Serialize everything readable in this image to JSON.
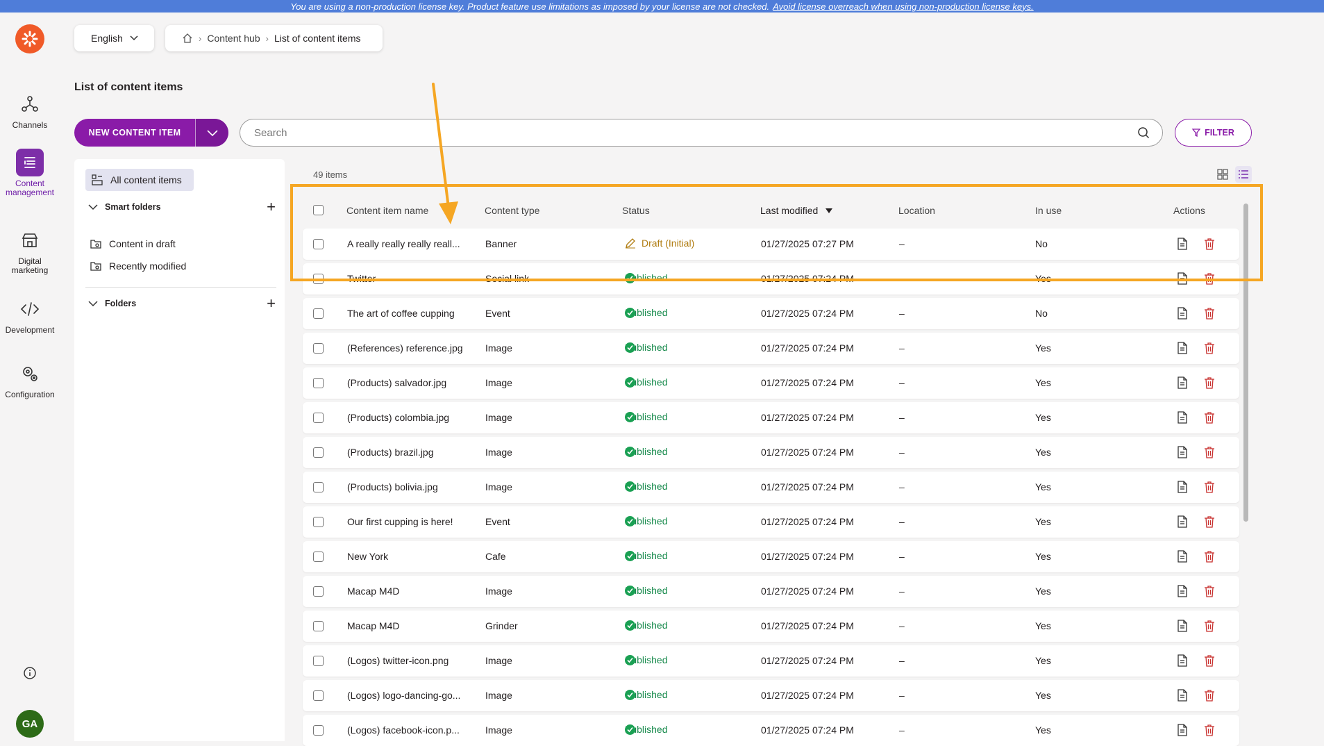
{
  "banner": {
    "text": "You are using a non-production license key. Product feature use limitations as imposed by your license are not checked.",
    "link": "Avoid license overreach when using non-production license keys."
  },
  "rail": {
    "items": [
      {
        "label": "Channels",
        "icon": "channels-icon"
      },
      {
        "label": "Content management",
        "icon": "content-management-icon",
        "active": true
      },
      {
        "label": "Digital marketing",
        "icon": "digital-marketing-icon"
      },
      {
        "label": "Development",
        "icon": "code-icon"
      },
      {
        "label": "Configuration",
        "icon": "gears-icon"
      }
    ],
    "avatar": "GA"
  },
  "header": {
    "language": "English",
    "breadcrumb": [
      "Content hub",
      "List of content items"
    ],
    "title": "List of content items"
  },
  "toolbar": {
    "new_label": "NEW CONTENT ITEM",
    "search_placeholder": "Search",
    "filter_label": "FILTER"
  },
  "folders": {
    "all_items": "All content items",
    "smart_folders_label": "Smart folders",
    "smart_folders": [
      "Content in draft",
      "Recently modified"
    ],
    "folders_label": "Folders"
  },
  "list": {
    "count": "49 items",
    "columns": {
      "name": "Content item name",
      "type": "Content type",
      "status": "Status",
      "modified": "Last modified",
      "location": "Location",
      "in_use": "In use",
      "actions": "Actions"
    },
    "sort_column": "Last modified",
    "sort_direction": "descending",
    "rows": [
      {
        "name": "A really really really reall...",
        "type": "Banner",
        "status": "Draft (Initial)",
        "status_kind": "draft",
        "modified": "01/27/2025 07:27 PM",
        "location": "–",
        "in_use": "No"
      },
      {
        "name": "Twitter",
        "type": "Social link",
        "status": "Published",
        "status_kind": "published",
        "modified": "01/27/2025 07:24 PM",
        "location": "–",
        "in_use": "Yes"
      },
      {
        "name": "The art of coffee cupping",
        "type": "Event",
        "status": "Published",
        "status_kind": "published",
        "modified": "01/27/2025 07:24 PM",
        "location": "–",
        "in_use": "No"
      },
      {
        "name": "(References) reference.jpg",
        "type": "Image",
        "status": "Published",
        "status_kind": "published",
        "modified": "01/27/2025 07:24 PM",
        "location": "–",
        "in_use": "Yes"
      },
      {
        "name": "(Products) salvador.jpg",
        "type": "Image",
        "status": "Published",
        "status_kind": "published",
        "modified": "01/27/2025 07:24 PM",
        "location": "–",
        "in_use": "Yes"
      },
      {
        "name": "(Products) colombia.jpg",
        "type": "Image",
        "status": "Published",
        "status_kind": "published",
        "modified": "01/27/2025 07:24 PM",
        "location": "–",
        "in_use": "Yes"
      },
      {
        "name": "(Products) brazil.jpg",
        "type": "Image",
        "status": "Published",
        "status_kind": "published",
        "modified": "01/27/2025 07:24 PM",
        "location": "–",
        "in_use": "Yes"
      },
      {
        "name": "(Products) bolivia.jpg",
        "type": "Image",
        "status": "Published",
        "status_kind": "published",
        "modified": "01/27/2025 07:24 PM",
        "location": "–",
        "in_use": "Yes"
      },
      {
        "name": "Our first cupping is here!",
        "type": "Event",
        "status": "Published",
        "status_kind": "published",
        "modified": "01/27/2025 07:24 PM",
        "location": "–",
        "in_use": "Yes"
      },
      {
        "name": "New York",
        "type": "Cafe",
        "status": "Published",
        "status_kind": "published",
        "modified": "01/27/2025 07:24 PM",
        "location": "–",
        "in_use": "Yes"
      },
      {
        "name": "Macap M4D",
        "type": "Image",
        "status": "Published",
        "status_kind": "published",
        "modified": "01/27/2025 07:24 PM",
        "location": "–",
        "in_use": "Yes"
      },
      {
        "name": "Macap M4D",
        "type": "Grinder",
        "status": "Published",
        "status_kind": "published",
        "modified": "01/27/2025 07:24 PM",
        "location": "–",
        "in_use": "Yes"
      },
      {
        "name": "(Logos) twitter-icon.png",
        "type": "Image",
        "status": "Published",
        "status_kind": "published",
        "modified": "01/27/2025 07:24 PM",
        "location": "–",
        "in_use": "Yes"
      },
      {
        "name": "(Logos) logo-dancing-go...",
        "type": "Image",
        "status": "Published",
        "status_kind": "published",
        "modified": "01/27/2025 07:24 PM",
        "location": "–",
        "in_use": "Yes"
      },
      {
        "name": "(Logos) facebook-icon.p...",
        "type": "Image",
        "status": "Published",
        "status_kind": "published",
        "modified": "01/27/2025 07:24 PM",
        "location": "–",
        "in_use": "Yes"
      }
    ]
  },
  "colors": {
    "accent": "#8a1ba8",
    "banner": "#4f7dd9",
    "highlight": "#f5a623",
    "published": "#1aa053",
    "draft": "#b07c10",
    "delete": "#c8312f"
  }
}
